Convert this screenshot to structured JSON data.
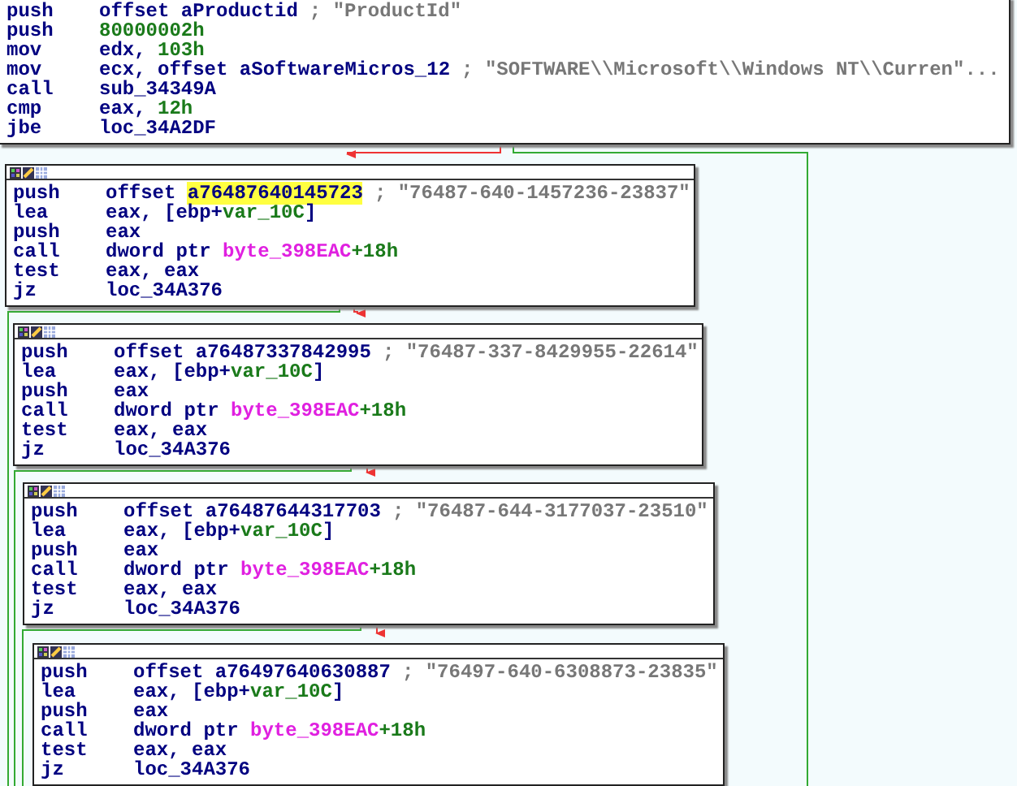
{
  "graph": {
    "blocks": [
      {
        "header": false,
        "lines": [
          {
            "mnemonic": "push",
            "operands": [
              {
                "text": "offset aProductid",
                "kind": "code"
              }
            ],
            "comment": "; \"ProductId\""
          },
          {
            "mnemonic": "push",
            "operands": [
              {
                "text": "80000002h",
                "kind": "number"
              }
            ]
          },
          {
            "mnemonic": "mov",
            "operands": [
              {
                "text": "edx, ",
                "kind": "code"
              },
              {
                "text": "103h",
                "kind": "number"
              }
            ]
          },
          {
            "mnemonic": "mov",
            "operands": [
              {
                "text": "ecx, offset aSoftwareMicros_12",
                "kind": "code"
              }
            ],
            "comment": "; \"SOFTWARE\\\\Microsoft\\\\Windows NT\\\\Curren\"..."
          },
          {
            "mnemonic": "call",
            "operands": [
              {
                "text": "sub_34349A",
                "kind": "code"
              }
            ]
          },
          {
            "mnemonic": "cmp",
            "operands": [
              {
                "text": "eax, ",
                "kind": "code"
              },
              {
                "text": "12h",
                "kind": "number"
              }
            ]
          },
          {
            "mnemonic": "jbe",
            "operands": [
              {
                "text": "loc_34A2DF",
                "kind": "code"
              }
            ]
          }
        ]
      },
      {
        "header": true,
        "lines": [
          {
            "mnemonic": "push",
            "operands": [
              {
                "text": "offset ",
                "kind": "code"
              },
              {
                "text": "a76487640145723",
                "kind": "highlight"
              }
            ],
            "comment": "; \"76487-640-1457236-23837\""
          },
          {
            "mnemonic": "lea",
            "operands": [
              {
                "text": "eax, [ebp+",
                "kind": "code"
              },
              {
                "text": "var_10C",
                "kind": "number"
              },
              {
                "text": "]",
                "kind": "code"
              }
            ]
          },
          {
            "mnemonic": "push",
            "operands": [
              {
                "text": "eax",
                "kind": "code"
              }
            ]
          },
          {
            "mnemonic": "call",
            "operands": [
              {
                "text": "dword ptr ",
                "kind": "code"
              },
              {
                "text": "byte_398EAC",
                "kind": "import"
              },
              {
                "text": "+18h",
                "kind": "number"
              }
            ]
          },
          {
            "mnemonic": "test",
            "operands": [
              {
                "text": "eax, eax",
                "kind": "code"
              }
            ]
          },
          {
            "mnemonic": "jz",
            "operands": [
              {
                "text": "loc_34A376",
                "kind": "code"
              }
            ]
          }
        ]
      },
      {
        "header": true,
        "lines": [
          {
            "mnemonic": "push",
            "operands": [
              {
                "text": "offset a76487337842995",
                "kind": "code"
              }
            ],
            "comment": "; \"76487-337-8429955-22614\""
          },
          {
            "mnemonic": "lea",
            "operands": [
              {
                "text": "eax, [ebp+",
                "kind": "code"
              },
              {
                "text": "var_10C",
                "kind": "number"
              },
              {
                "text": "]",
                "kind": "code"
              }
            ]
          },
          {
            "mnemonic": "push",
            "operands": [
              {
                "text": "eax",
                "kind": "code"
              }
            ]
          },
          {
            "mnemonic": "call",
            "operands": [
              {
                "text": "dword ptr ",
                "kind": "code"
              },
              {
                "text": "byte_398EAC",
                "kind": "import"
              },
              {
                "text": "+18h",
                "kind": "number"
              }
            ]
          },
          {
            "mnemonic": "test",
            "operands": [
              {
                "text": "eax, eax",
                "kind": "code"
              }
            ]
          },
          {
            "mnemonic": "jz",
            "operands": [
              {
                "text": "loc_34A376",
                "kind": "code"
              }
            ]
          }
        ]
      },
      {
        "header": true,
        "lines": [
          {
            "mnemonic": "push",
            "operands": [
              {
                "text": "offset a76487644317703",
                "kind": "code"
              }
            ],
            "comment": "; \"76487-644-3177037-23510\""
          },
          {
            "mnemonic": "lea",
            "operands": [
              {
                "text": "eax, [ebp+",
                "kind": "code"
              },
              {
                "text": "var_10C",
                "kind": "number"
              },
              {
                "text": "]",
                "kind": "code"
              }
            ]
          },
          {
            "mnemonic": "push",
            "operands": [
              {
                "text": "eax",
                "kind": "code"
              }
            ]
          },
          {
            "mnemonic": "call",
            "operands": [
              {
                "text": "dword ptr ",
                "kind": "code"
              },
              {
                "text": "byte_398EAC",
                "kind": "import"
              },
              {
                "text": "+18h",
                "kind": "number"
              }
            ]
          },
          {
            "mnemonic": "test",
            "operands": [
              {
                "text": "eax, eax",
                "kind": "code"
              }
            ]
          },
          {
            "mnemonic": "jz",
            "operands": [
              {
                "text": "loc_34A376",
                "kind": "code"
              }
            ]
          }
        ]
      },
      {
        "header": true,
        "lines": [
          {
            "mnemonic": "push",
            "operands": [
              {
                "text": "offset a76497640630887",
                "kind": "code"
              }
            ],
            "comment": "; \"76497-640-6308873-23835\""
          },
          {
            "mnemonic": "lea",
            "operands": [
              {
                "text": "eax, [ebp+",
                "kind": "code"
              },
              {
                "text": "var_10C",
                "kind": "number"
              },
              {
                "text": "]",
                "kind": "code"
              }
            ]
          },
          {
            "mnemonic": "push",
            "operands": [
              {
                "text": "eax",
                "kind": "code"
              }
            ]
          },
          {
            "mnemonic": "call",
            "operands": [
              {
                "text": "dword ptr ",
                "kind": "code"
              },
              {
                "text": "byte_398EAC",
                "kind": "import"
              },
              {
                "text": "+18h",
                "kind": "number"
              }
            ]
          },
          {
            "mnemonic": "test",
            "operands": [
              {
                "text": "eax, eax",
                "kind": "code"
              }
            ]
          },
          {
            "mnemonic": "jz",
            "operands": [
              {
                "text": "loc_34A376",
                "kind": "code"
              }
            ]
          }
        ]
      }
    ]
  }
}
